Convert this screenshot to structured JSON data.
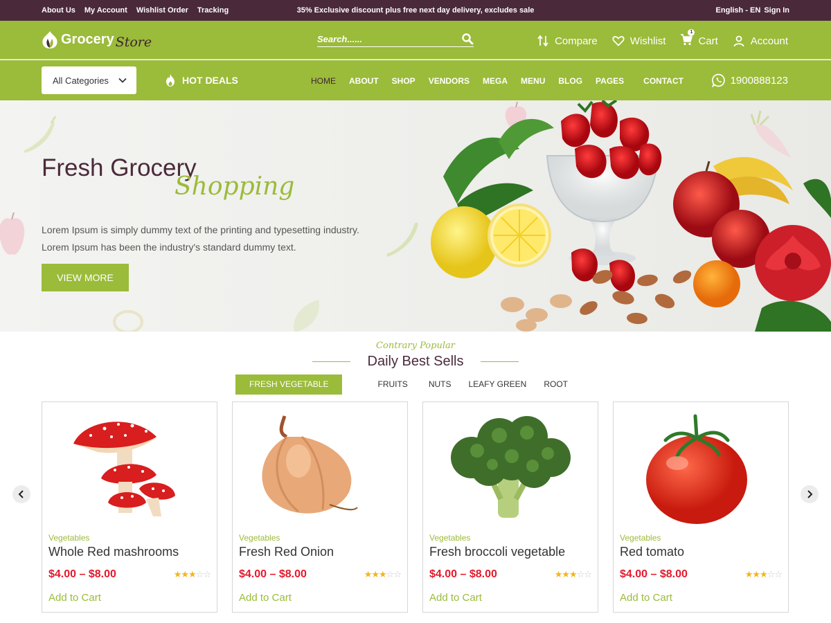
{
  "topbar": {
    "links": [
      "About Us",
      "My Account",
      "Wishlist Order",
      "Tracking"
    ],
    "promo": "35% Exclusive discount plus free next day delivery, excludes sale",
    "language": "English - EN",
    "signin": "Sign In"
  },
  "header": {
    "logo_word": "Grocery",
    "logo_script": "Store",
    "search_placeholder": "Search......",
    "compare": "Compare",
    "wishlist": "Wishlist",
    "cart": "Cart",
    "cart_count": "1",
    "account": "Account"
  },
  "navbar": {
    "category": "All Categories",
    "hot_deals": "HOT DEALS",
    "menu": [
      "HOME",
      "ABOUT",
      "SHOP",
      "VENDORS",
      "MEGA",
      "MENU",
      "BLOG",
      "PAGES"
    ],
    "contact": "CONTACT",
    "phone": "1900888123"
  },
  "hero": {
    "title": "Fresh Grocery",
    "script": "Shopping",
    "description": "Lorem Ipsum is simply dummy text of the printing and typesetting industry. Lorem Ipsum has been the industry's standard dummy text.",
    "button": "VIEW MORE"
  },
  "section": {
    "script": "Contrary Popular",
    "title": "Daily Best Sells",
    "tabs": [
      "FRESH VEGETABLE",
      "FRUITS",
      "NUTS",
      "LEAFY GREEN",
      "ROOT"
    ]
  },
  "products": [
    {
      "category": "Vegetables",
      "name": "Whole Red mashrooms",
      "price": "$4.00 – $8.00",
      "rating": 3,
      "add": "Add to Cart",
      "icon": "mushroom"
    },
    {
      "category": "Vegetables",
      "name": "Fresh Red Onion",
      "price": "$4.00 – $8.00",
      "rating": 3,
      "add": "Add to Cart",
      "icon": "onion"
    },
    {
      "category": "Vegetables",
      "name": "Fresh broccoli vegetable",
      "price": "$4.00 – $8.00",
      "rating": 3,
      "add": "Add to Cart",
      "icon": "broccoli"
    },
    {
      "category": "Vegetables",
      "name": "Red tomato",
      "price": "$4.00 – $8.00",
      "rating": 3,
      "add": "Add to Cart",
      "icon": "tomato"
    }
  ],
  "colors": {
    "green": "#9bbb3a",
    "plum": "#4a2a3a",
    "price_red": "#e5192c",
    "star": "#f2b51d"
  }
}
